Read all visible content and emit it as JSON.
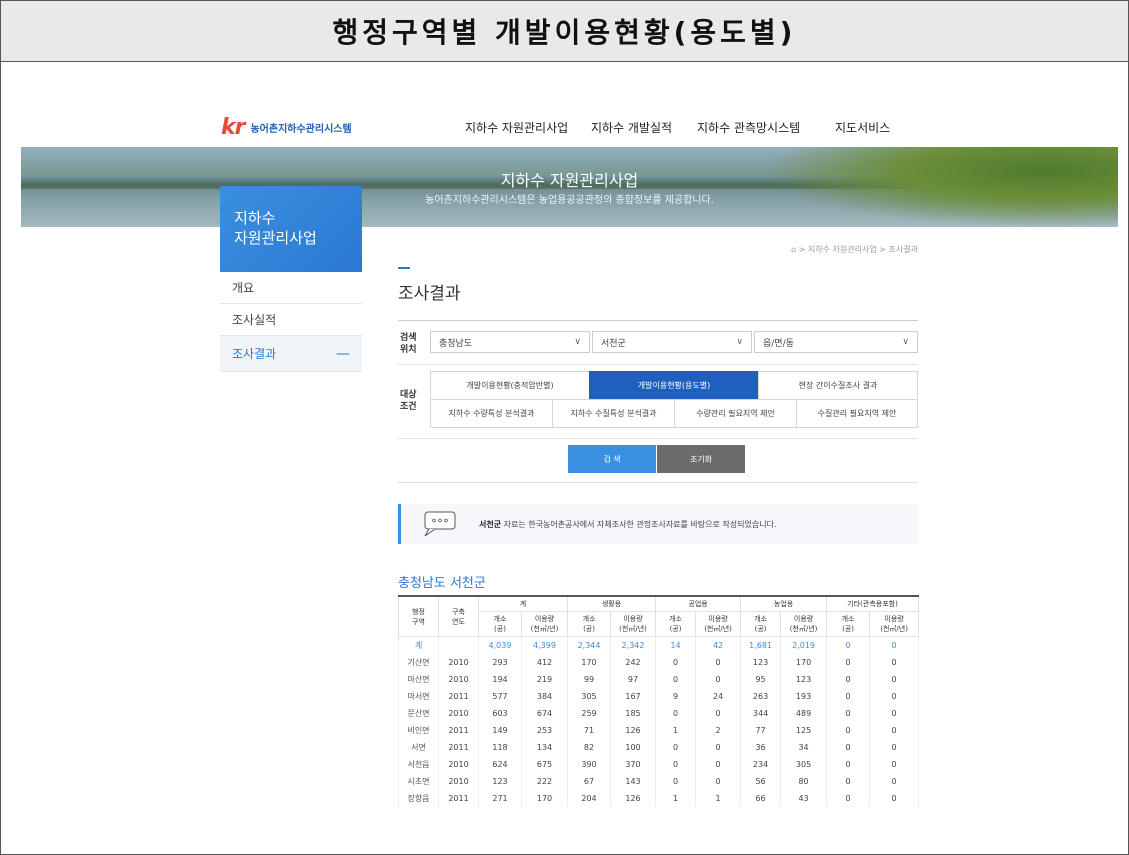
{
  "frame_title": "행정구역별 개발이용현황(용도별)",
  "logo": {
    "mark": "kr",
    "text": "농어촌지하수관리시스템"
  },
  "gnb": [
    "지하수 자원관리사업",
    "지하수 개발실적",
    "지하수 관측망시스템",
    "지도서비스"
  ],
  "banner": {
    "title": "지하수 자원관리사업",
    "subtitle": "농어촌지하수관리시스템은 농업용공공관정의 종합정보를 제공합니다."
  },
  "side": {
    "title_line1": "지하수",
    "title_line2": "자원관리사업",
    "menu": [
      {
        "label": "개요"
      },
      {
        "label": "조사실적"
      },
      {
        "label": "조사결과",
        "active_mark": "—"
      }
    ]
  },
  "breadcrumb": "⌂ > 지하수 자원관리사업 > 조사결과",
  "page_title": "조사결과",
  "search": {
    "location_label_1": "검색",
    "location_label_2": "위치",
    "province": "충청남도",
    "county": "서천군",
    "town": "읍/면/동",
    "chevron": "∨",
    "condition_label_1": "대상",
    "condition_label_2": "조건",
    "conditions_row1": [
      "개발이용현황(충적암반별)",
      "개발이용현황(용도별)",
      "현장 간이수질조사 결과"
    ],
    "conditions_row2": [
      "지하수 수량특성 분석결과",
      "지하수 수질특성 분석결과",
      "수량관리 필요지역 제안",
      "수질관리 필요지역 제안"
    ],
    "search_button": "검 색",
    "reset_button": "초기화"
  },
  "notice": {
    "region": "서천군",
    "text": " 자료는 한국농어촌공사에서 자체조사한 관정조사자료를 바탕으로 작성되었습니다."
  },
  "region_title": "충청남도 서천군",
  "table": {
    "head_region": "행정\n구역",
    "head_year": "구축\n연도",
    "groups": [
      "계",
      "생활용",
      "공업용",
      "농업용",
      "기타(관측용포함)"
    ],
    "sub_count": "개소\n(공)",
    "sub_usage": "이용량\n(천㎥/년)",
    "rows": [
      [
        "계",
        "",
        "4,039",
        "4,399",
        "2,344",
        "2,342",
        "14",
        "42",
        "1,681",
        "2,019",
        "0",
        "0"
      ],
      [
        "기산면",
        "2010",
        "293",
        "412",
        "170",
        "242",
        "0",
        "0",
        "123",
        "170",
        "0",
        "0"
      ],
      [
        "마산면",
        "2010",
        "194",
        "219",
        "99",
        "97",
        "0",
        "0",
        "95",
        "123",
        "0",
        "0"
      ],
      [
        "마서면",
        "2011",
        "577",
        "384",
        "305",
        "167",
        "9",
        "24",
        "263",
        "193",
        "0",
        "0"
      ],
      [
        "문산면",
        "2010",
        "603",
        "674",
        "259",
        "185",
        "0",
        "0",
        "344",
        "489",
        "0",
        "0"
      ],
      [
        "비인면",
        "2011",
        "149",
        "253",
        "71",
        "126",
        "1",
        "2",
        "77",
        "125",
        "0",
        "0"
      ],
      [
        "서면",
        "2011",
        "118",
        "134",
        "82",
        "100",
        "0",
        "0",
        "36",
        "34",
        "0",
        "0"
      ],
      [
        "서천읍",
        "2010",
        "624",
        "675",
        "390",
        "370",
        "0",
        "0",
        "234",
        "305",
        "0",
        "0"
      ],
      [
        "시초면",
        "2010",
        "123",
        "222",
        "67",
        "143",
        "0",
        "0",
        "56",
        "80",
        "0",
        "0"
      ],
      [
        "장항읍",
        "2011",
        "271",
        "170",
        "204",
        "126",
        "1",
        "1",
        "66",
        "43",
        "0",
        "0"
      ]
    ]
  },
  "colors": {
    "accent": "#2b78d2",
    "active_tab": "#1f5fbf",
    "reset": "#6b6b6b"
  }
}
